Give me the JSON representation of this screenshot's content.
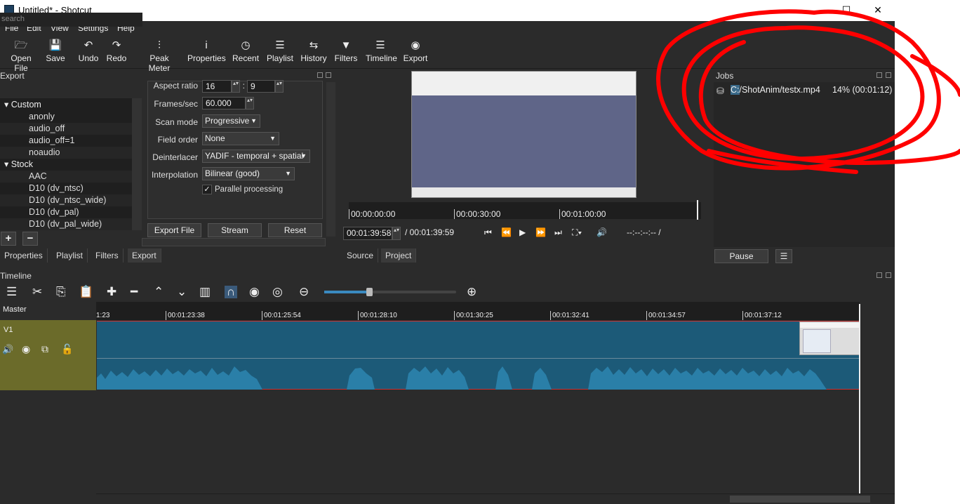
{
  "window": {
    "title": "Untitled* - Shotcut",
    "min": "—",
    "max": "☐",
    "close": "✕"
  },
  "menu": [
    "File",
    "Edit",
    "View",
    "Settings",
    "Help"
  ],
  "toolbar": [
    {
      "label": "Open File",
      "icon": "folder-open-icon",
      "glyph": "🗁"
    },
    {
      "label": "Save",
      "icon": "save-icon",
      "glyph": "💾"
    },
    {
      "label": "Undo",
      "icon": "undo-icon",
      "glyph": "↶"
    },
    {
      "label": "Redo",
      "icon": "redo-icon",
      "glyph": "↷"
    },
    {
      "label": "Peak Meter",
      "icon": "peak-meter-icon",
      "glyph": "⫶"
    },
    {
      "label": "Properties",
      "icon": "info-icon",
      "glyph": "i"
    },
    {
      "label": "Recent",
      "icon": "clock-icon",
      "glyph": "◷"
    },
    {
      "label": "Playlist",
      "icon": "list-icon",
      "glyph": "☰"
    },
    {
      "label": "History",
      "icon": "history-icon",
      "glyph": "⇆"
    },
    {
      "label": "Filters",
      "icon": "filter-icon",
      "glyph": "▼"
    },
    {
      "label": "Timeline",
      "icon": "timeline-icon",
      "glyph": "☰"
    },
    {
      "label": "Export",
      "icon": "disc-icon",
      "glyph": "◉"
    }
  ],
  "export": {
    "title": "Export",
    "search_placeholder": "search",
    "tree": [
      {
        "label": "Custom",
        "group": true
      },
      {
        "label": "anonly"
      },
      {
        "label": "audio_off"
      },
      {
        "label": "audio_off=1"
      },
      {
        "label": "noaudio"
      },
      {
        "label": "Stock",
        "group": true
      },
      {
        "label": "AAC"
      },
      {
        "label": "D10 (dv_ntsc)"
      },
      {
        "label": "D10 (dv_ntsc_wide)"
      },
      {
        "label": "D10 (dv_pal)"
      },
      {
        "label": "D10 (dv_pal_wide)"
      }
    ],
    "aspect_label": "Aspect ratio",
    "aspect_w": "16",
    "aspect_sep": ":",
    "aspect_h": "9",
    "fps_label": "Frames/sec",
    "fps": "60.000",
    "scan_label": "Scan mode",
    "scan": "Progressive",
    "field_label": "Field order",
    "field": "None",
    "deint_label": "Deinterlacer",
    "deint": "YADIF - temporal + spatial",
    "interp_label": "Interpolation",
    "interp": "Bilinear (good)",
    "parallel_label": "Parallel processing",
    "parallel_check": "✓",
    "export_file": "Export File",
    "stream": "Stream",
    "reset": "Reset",
    "add": "+",
    "remove": "−"
  },
  "left_tabs": [
    "Properties",
    "Playlist",
    "Filters",
    "Export"
  ],
  "player": {
    "ruler": [
      "00:00:00:00",
      "00:00:30:00",
      "00:01:00:00"
    ],
    "position": "00:01:39:58",
    "duration": "/ 00:01:39:59",
    "in_out": "--:--:--:-- /",
    "tabs": [
      "Source",
      "Project"
    ]
  },
  "jobs": {
    "title": "Jobs",
    "path_prefix": "C:",
    "path": "/ShotAnim/testx.mp4",
    "progress": "14% (00:01:12)",
    "pause": "Pause",
    "menu": "☰"
  },
  "timeline": {
    "title": "Timeline",
    "master": "Master",
    "track": "V1",
    "ticks": [
      "1:23",
      "00:01:23:38",
      "00:01:25:54",
      "00:01:28:10",
      "00:01:30:25",
      "00:01:32:41",
      "00:01:34:57",
      "00:01:37:12"
    ]
  },
  "colors": {
    "accent": "#1c5a78",
    "track_head": "#6b6b2a",
    "annotation": "#ff0000"
  }
}
